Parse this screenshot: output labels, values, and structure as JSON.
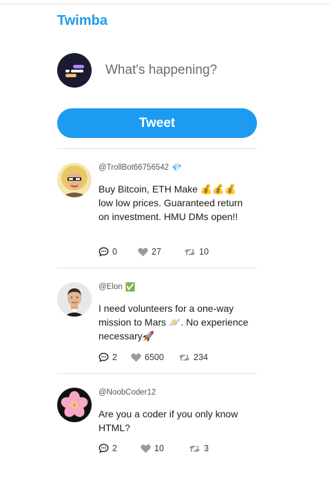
{
  "app": {
    "brand": "Twimba"
  },
  "composer": {
    "placeholder": "What's happening?",
    "button_label": "Tweet"
  },
  "tweets": [
    {
      "handle": "@TrollBot66756542",
      "badge": "💎",
      "text": "Buy Bitcoin, ETH Make 💰💰💰 low low prices. Guaranteed return on investment. HMU DMs open!!",
      "replies": "0",
      "likes": "27",
      "retweets": "10",
      "avatar_icon": "blonde-person-avatar"
    },
    {
      "handle": "@Elon",
      "badge": "✅",
      "text": "I need volunteers for a one-way mission to Mars 🪐. No experience necessary🚀",
      "replies": "2",
      "likes": "6500",
      "retweets": "234",
      "avatar_icon": "man-portrait-avatar"
    },
    {
      "handle": "@NoobCoder12",
      "badge": "",
      "text": "Are you a coder if you only know HTML?",
      "replies": "2",
      "likes": "10",
      "retweets": "3",
      "avatar_icon": "cherry-blossom-avatar"
    }
  ],
  "colors": {
    "accent": "#1d9bf0",
    "stat_icon": "#999999"
  }
}
